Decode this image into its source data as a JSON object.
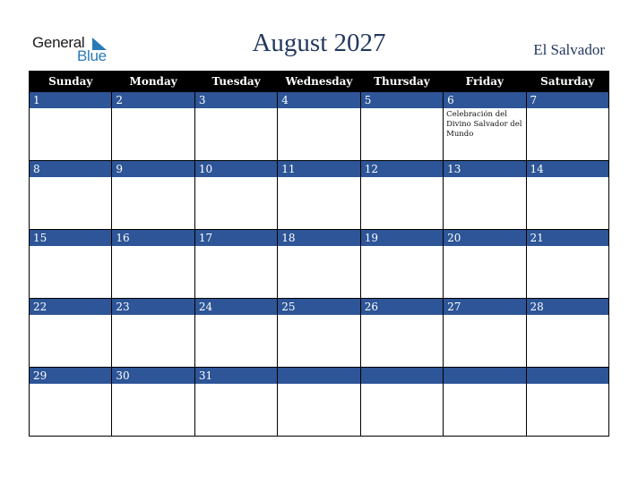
{
  "logo": {
    "word1": "General",
    "word2": "Blue",
    "icon": "triangle-icon"
  },
  "title": "August 2027",
  "country": "El Salvador",
  "colors": {
    "header_bg": "#000000",
    "day_band": "#2d5597",
    "title": "#23385e",
    "logo_blue": "#2a7ab8"
  },
  "weekdays": [
    "Sunday",
    "Monday",
    "Tuesday",
    "Wednesday",
    "Thursday",
    "Friday",
    "Saturday"
  ],
  "weeks": [
    [
      {
        "day": "1",
        "event": ""
      },
      {
        "day": "2",
        "event": ""
      },
      {
        "day": "3",
        "event": ""
      },
      {
        "day": "4",
        "event": ""
      },
      {
        "day": "5",
        "event": ""
      },
      {
        "day": "6",
        "event": "Celebración del Divino Salvador del Mundo"
      },
      {
        "day": "7",
        "event": ""
      }
    ],
    [
      {
        "day": "8",
        "event": ""
      },
      {
        "day": "9",
        "event": ""
      },
      {
        "day": "10",
        "event": ""
      },
      {
        "day": "11",
        "event": ""
      },
      {
        "day": "12",
        "event": ""
      },
      {
        "day": "13",
        "event": ""
      },
      {
        "day": "14",
        "event": ""
      }
    ],
    [
      {
        "day": "15",
        "event": ""
      },
      {
        "day": "16",
        "event": ""
      },
      {
        "day": "17",
        "event": ""
      },
      {
        "day": "18",
        "event": ""
      },
      {
        "day": "19",
        "event": ""
      },
      {
        "day": "20",
        "event": ""
      },
      {
        "day": "21",
        "event": ""
      }
    ],
    [
      {
        "day": "22",
        "event": ""
      },
      {
        "day": "23",
        "event": ""
      },
      {
        "day": "24",
        "event": ""
      },
      {
        "day": "25",
        "event": ""
      },
      {
        "day": "26",
        "event": ""
      },
      {
        "day": "27",
        "event": ""
      },
      {
        "day": "28",
        "event": ""
      }
    ],
    [
      {
        "day": "29",
        "event": ""
      },
      {
        "day": "30",
        "event": ""
      },
      {
        "day": "31",
        "event": ""
      },
      {
        "day": "",
        "event": ""
      },
      {
        "day": "",
        "event": ""
      },
      {
        "day": "",
        "event": ""
      },
      {
        "day": "",
        "event": ""
      }
    ]
  ]
}
